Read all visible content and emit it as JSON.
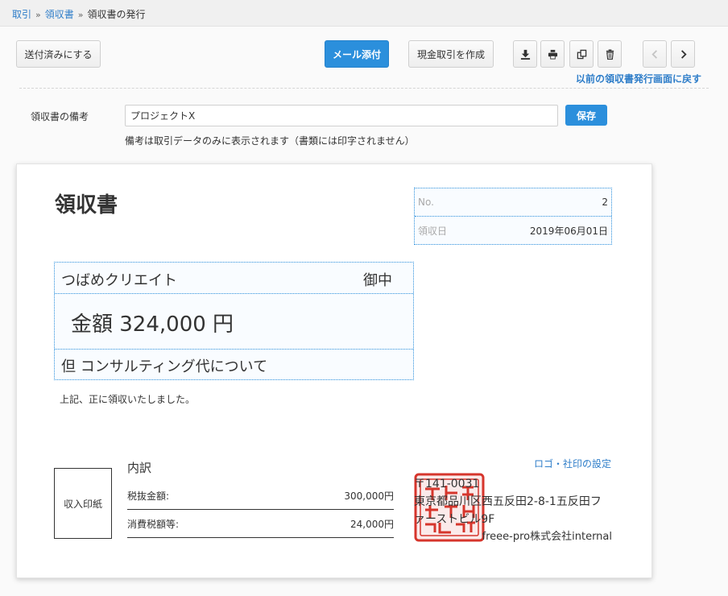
{
  "breadcrumb": {
    "items": [
      "取引",
      "領収書",
      "領収書の発行"
    ],
    "separator": "»"
  },
  "toolbar": {
    "mark_sent": "送付済みにする",
    "mail_attach": "メール添付",
    "create_cash_deal": "現金取引を作成",
    "back_link": "以前の領収書発行画面に戻す"
  },
  "memo": {
    "label": "領収書の備考",
    "value": "プロジェクトX",
    "save": "保存",
    "note": "備考は取引データのみに表示されます（書類には印字されません）"
  },
  "receipt": {
    "title": "領収書",
    "no_label": "No.",
    "no_value": "2",
    "date_label": "領収日",
    "date_value": "2019年06月01日",
    "addressee": "つばめクリエイト",
    "honorific": "御中",
    "amount": "金額 324,000 円",
    "purpose": "但 コンサルティング代について",
    "acknowledgement": "上記、正に領収いたしました。",
    "revenue_stamp": "収入印紙",
    "breakdown_title": "内訳",
    "breakdown": [
      {
        "label": "税抜金額:",
        "value": "300,000円"
      },
      {
        "label": "消費税額等:",
        "value": "24,000円"
      }
    ],
    "logo_setting": "ロゴ・社印の設定",
    "issuer": {
      "postal": "〒141-0031",
      "address": "東京都品川区西五反田2-8-1五反田ファーストビル9F",
      "company": "freee-pro株式会社internal"
    },
    "seal_color": "#d6352c"
  },
  "colors": {
    "accent": "#2b8fdc",
    "link": "#2f7ec9"
  }
}
